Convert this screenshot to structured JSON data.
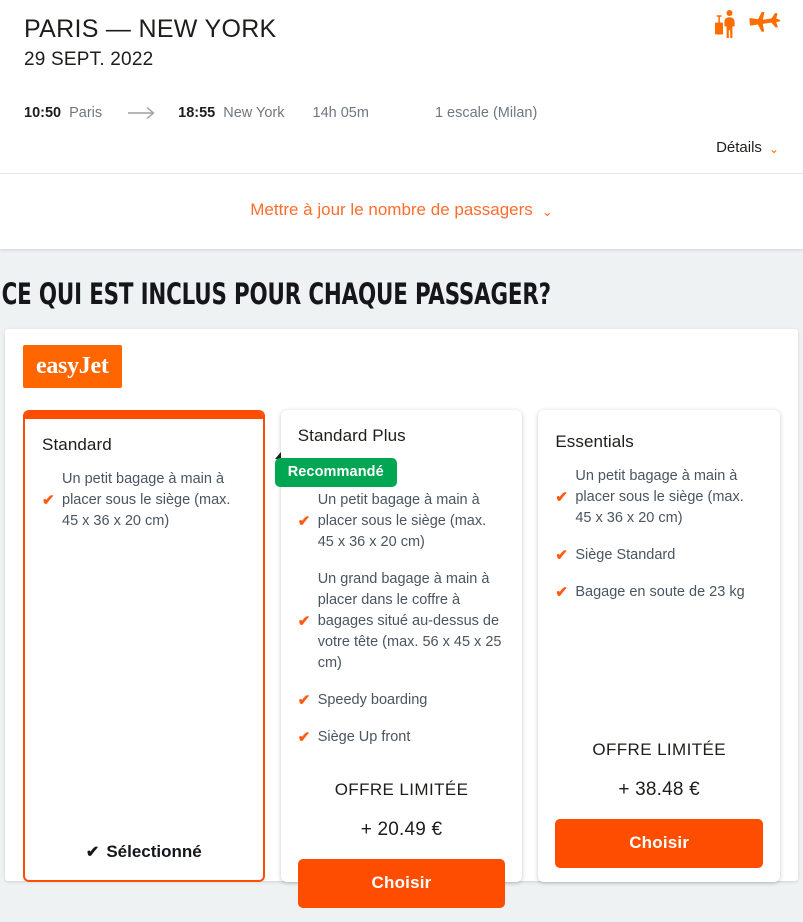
{
  "header": {
    "route": "PARIS — NEW YORK",
    "date": "29 SEPT. 2022",
    "icons": [
      "traveler-luggage-icon",
      "airplane-icon"
    ]
  },
  "flight": {
    "depart_time": "10:50",
    "depart_city": "Paris",
    "arrow": "→",
    "arrive_time": "18:55",
    "arrive_city": "New York",
    "duration": "14h 05m",
    "stops": "1 escale (Milan)",
    "details_label": "Détails",
    "details_chevron": "⌄"
  },
  "passengers": {
    "update_label": "Mettre à jour le nombre de passagers",
    "chevron": "⌄"
  },
  "section": {
    "heading": "CE QUI EST INCLUS POUR CHAQUE PASSAGER?"
  },
  "airline": {
    "logo_text": "easyJet",
    "logo_color": "#ff6600"
  },
  "colors": {
    "orange": "#ff4d00",
    "green": "#00a651",
    "tick": "#ff5b14",
    "page_bg": "#eef2f3"
  },
  "cards": [
    {
      "name": "Standard",
      "title": "Standard",
      "accent": "#ff4d00",
      "badge": null,
      "features": [
        {
          "tick": "✔",
          "text": "Un petit bagage à main à placer sous le siège (max. 45 x 36 x 20 cm)"
        }
      ],
      "offer_label": null,
      "price": null,
      "cta_label": null,
      "selected_label": "Sélectionné",
      "selected_check": "✔",
      "state": "selected"
    },
    {
      "name": "Standard Plus",
      "title": "Standard Plus",
      "accent": "#00a651",
      "badge": "Recommandé",
      "features": [
        {
          "tick": "✔",
          "text": "Un petit bagage à main à placer sous le siège (max. 45 x 36 x 20 cm)"
        },
        {
          "tick": "✔",
          "text": "Un grand bagage à main à placer dans le coffre à bagages situé au-dessus de votre tête (max. 56 x 45 x 25 cm)"
        },
        {
          "tick": "✔",
          "text": "Speedy boarding"
        },
        {
          "tick": "✔",
          "text": "Siège Up front"
        }
      ],
      "offer_label": "OFFRE LIMITÉE",
      "price": "+ 20.49 €",
      "cta_label": "Choisir",
      "selected_label": null,
      "state": "recommended"
    },
    {
      "name": "Essentials",
      "title": "Essentials",
      "accent": null,
      "badge": null,
      "features": [
        {
          "tick": "✔",
          "text": "Un petit bagage à main à placer sous le siège (max. 45 x 36 x 20 cm)"
        },
        {
          "tick": "✔",
          "text": "Siège Standard"
        },
        {
          "tick": "✔",
          "text": "Bagage en soute de 23 kg"
        }
      ],
      "offer_label": "OFFRE LIMITÉE",
      "price": "+ 38.48 €",
      "cta_label": "Choisir",
      "selected_label": null,
      "state": "default"
    }
  ]
}
